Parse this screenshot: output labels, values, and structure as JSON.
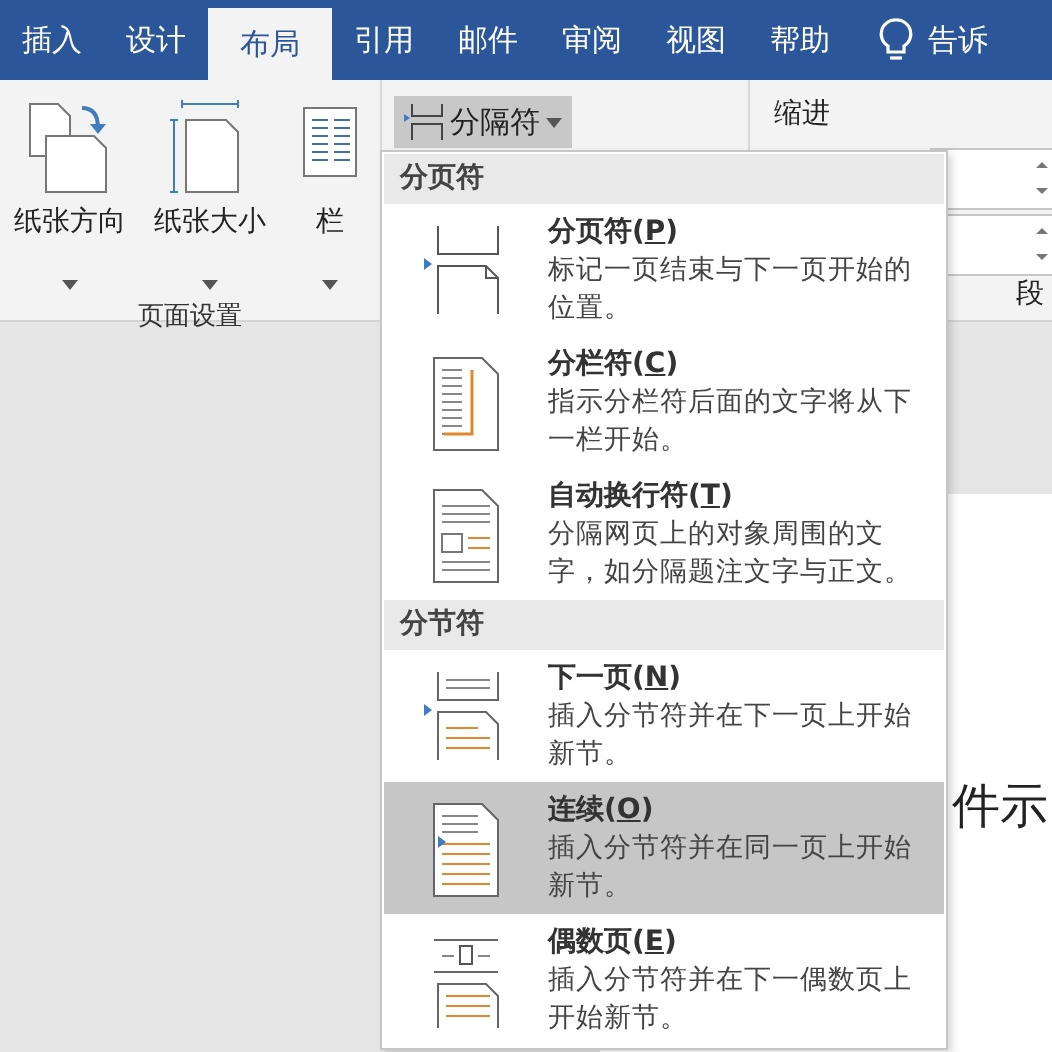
{
  "tabs": [
    {
      "label": "插入",
      "selected": false
    },
    {
      "label": "设计",
      "selected": false
    },
    {
      "label": "布局",
      "selected": true
    },
    {
      "label": "引用",
      "selected": false
    },
    {
      "label": "邮件",
      "selected": false
    },
    {
      "label": "审阅",
      "selected": false
    },
    {
      "label": "视图",
      "selected": false
    },
    {
      "label": "帮助",
      "selected": false
    }
  ],
  "tell_me": "告诉",
  "ribbon": {
    "page_setup": {
      "buttons": [
        {
          "kind": "orientation",
          "label": "纸张方向"
        },
        {
          "kind": "size",
          "label": "纸张大小"
        },
        {
          "kind": "columns",
          "label": "栏"
        }
      ],
      "label": "页面设置"
    },
    "breaks_button": {
      "label": "分隔符",
      "expanded": true
    },
    "indent_label": "缩进",
    "paragraph_label": "段"
  },
  "menu": {
    "sections": [
      {
        "header": "分页符",
        "items": [
          {
            "kind": "page",
            "title": "分页符(",
            "key": "P",
            "close": ")",
            "description": "标记一页结束与下一页开始的位置。",
            "selected": false
          },
          {
            "kind": "column",
            "title": "分栏符(",
            "key": "C",
            "close": ")",
            "description": "指示分栏符后面的文字将从下一栏开始。",
            "selected": false
          },
          {
            "kind": "wrap",
            "title": "自动换行符(",
            "key": "T",
            "close": ")",
            "description": "分隔网页上的对象周围的文字，如分隔题注文字与正文。",
            "selected": false
          }
        ]
      },
      {
        "header": "分节符",
        "items": [
          {
            "kind": "next_page",
            "title": "下一页(",
            "key": "N",
            "close": ")",
            "description": "插入分节符并在下一页上开始新节。",
            "selected": false
          },
          {
            "kind": "continuous",
            "title": "连续(",
            "key": "O",
            "close": ")",
            "description": "插入分节符并在同一页上开始新节。",
            "selected": true
          },
          {
            "kind": "even_page",
            "title": "偶数页(",
            "key": "E",
            "close": ")",
            "description": "插入分节符并在下一偶数页上开始新节。",
            "selected": false
          }
        ]
      }
    ]
  },
  "document_text": "件示"
}
